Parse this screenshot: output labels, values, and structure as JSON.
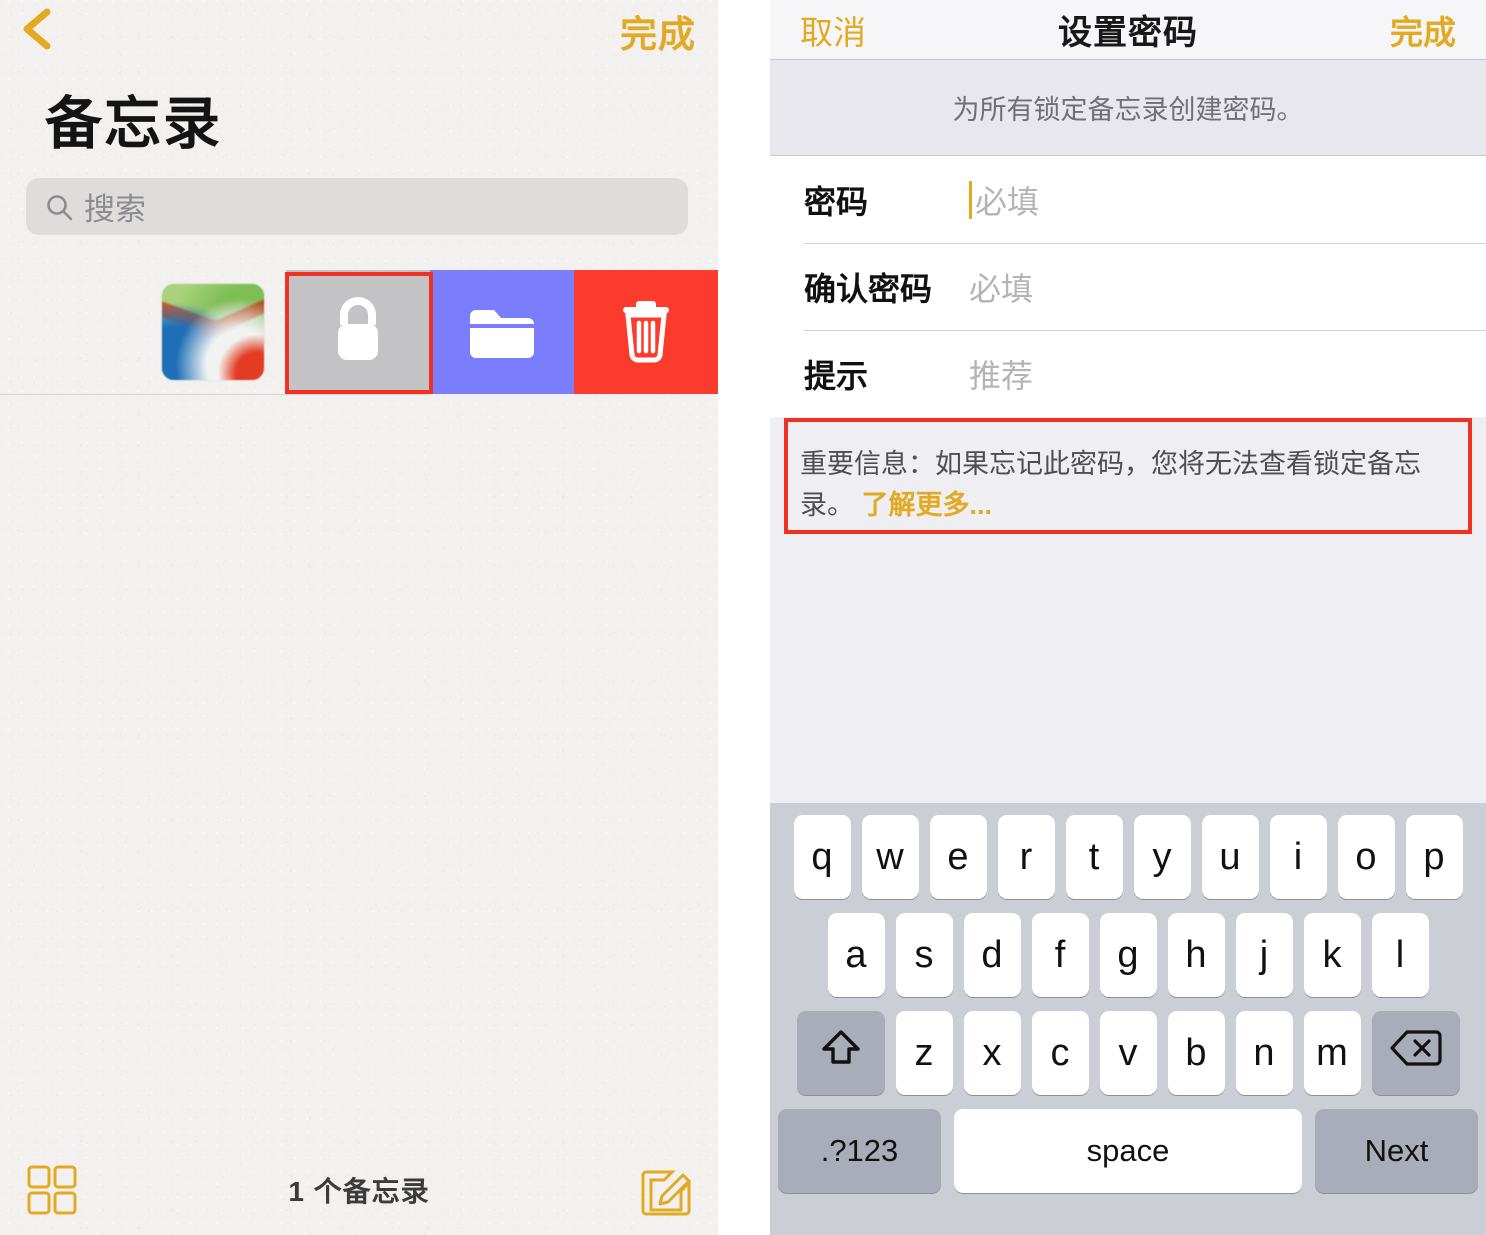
{
  "left_panel": {
    "back_icon": "chevron-left-icon",
    "done_label": "完成",
    "title": "备忘录",
    "search": {
      "icon": "search-icon",
      "placeholder": "搜索",
      "value": ""
    },
    "note_row": {
      "thumbnail_alt": "note-thumbnail",
      "swipe_actions": [
        {
          "name": "lock",
          "icon": "lock-icon",
          "color": "#c3c3c5",
          "highlighted": true
        },
        {
          "name": "move-to-folder",
          "icon": "folder-icon",
          "color": "#7a7dfc",
          "highlighted": false
        },
        {
          "name": "delete",
          "icon": "trash-icon",
          "color": "#fb3b2b",
          "highlighted": false
        }
      ]
    },
    "bottom_bar": {
      "grid_icon": "grid-view-icon",
      "count_label": "1 个备忘录",
      "compose_icon": "compose-icon"
    }
  },
  "right_panel": {
    "header": {
      "cancel_label": "取消",
      "title": "设置密码",
      "done_label": "完成"
    },
    "description": "为所有锁定备忘录创建密码。",
    "form_rows": [
      {
        "label": "密码",
        "placeholder": "必填",
        "value": "",
        "focused": true
      },
      {
        "label": "确认密码",
        "placeholder": "必填",
        "value": "",
        "focused": false
      },
      {
        "label": "提示",
        "placeholder": "推荐",
        "value": "",
        "focused": false
      }
    ],
    "warning": {
      "text": "重要信息：如果忘记此密码，您将无法查看锁定备忘录。",
      "link_label": "了解更多...",
      "highlighted": true
    },
    "keyboard": {
      "row1": [
        "q",
        "w",
        "e",
        "r",
        "t",
        "y",
        "u",
        "i",
        "o",
        "p"
      ],
      "row2": [
        "a",
        "s",
        "d",
        "f",
        "g",
        "h",
        "j",
        "k",
        "l"
      ],
      "row3_letters": [
        "z",
        "x",
        "c",
        "v",
        "b",
        "n",
        "m"
      ],
      "shift_icon": "shift-icon",
      "backspace_icon": "backspace-icon",
      "numbers_label": ".?123",
      "space_label": "space",
      "return_label": "Next"
    }
  },
  "colors": {
    "accent_gold": "#e2a922",
    "annotation_red": "#ef3124",
    "folder_blue": "#7a7dfc",
    "delete_red": "#fb3b2b",
    "lock_gray": "#c3c3c5",
    "keyboard_bg": "#ccced6"
  }
}
